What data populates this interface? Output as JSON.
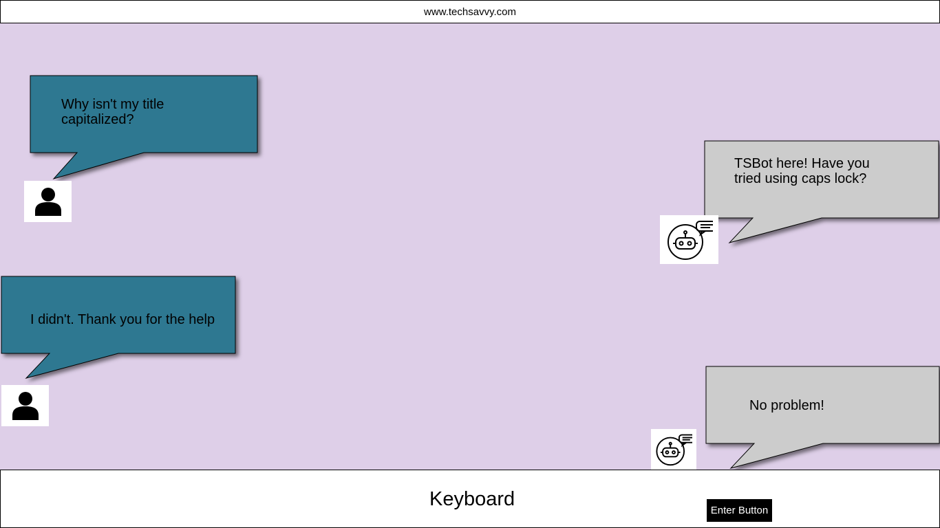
{
  "browser": {
    "url": "www.techsavvy.com"
  },
  "colors": {
    "background": "#decfe8",
    "user_bubble": "#2e7891",
    "bot_bubble": "#cccccc"
  },
  "messages": [
    {
      "sender": "user",
      "text": "Why isn't my title capitalized?",
      "avatar_icon": "user-silhouette-icon"
    },
    {
      "sender": "bot",
      "text": "TSBot here! Have you tried using caps lock?",
      "avatar_icon": "robot-chat-icon"
    },
    {
      "sender": "user",
      "text": "I didn't. Thank you for the help",
      "avatar_icon": "user-silhouette-icon"
    },
    {
      "sender": "bot",
      "text": "No problem!",
      "avatar_icon": "robot-chat-icon"
    }
  ],
  "keyboard": {
    "label": "Keyboard",
    "enter_label": "Enter Button"
  }
}
